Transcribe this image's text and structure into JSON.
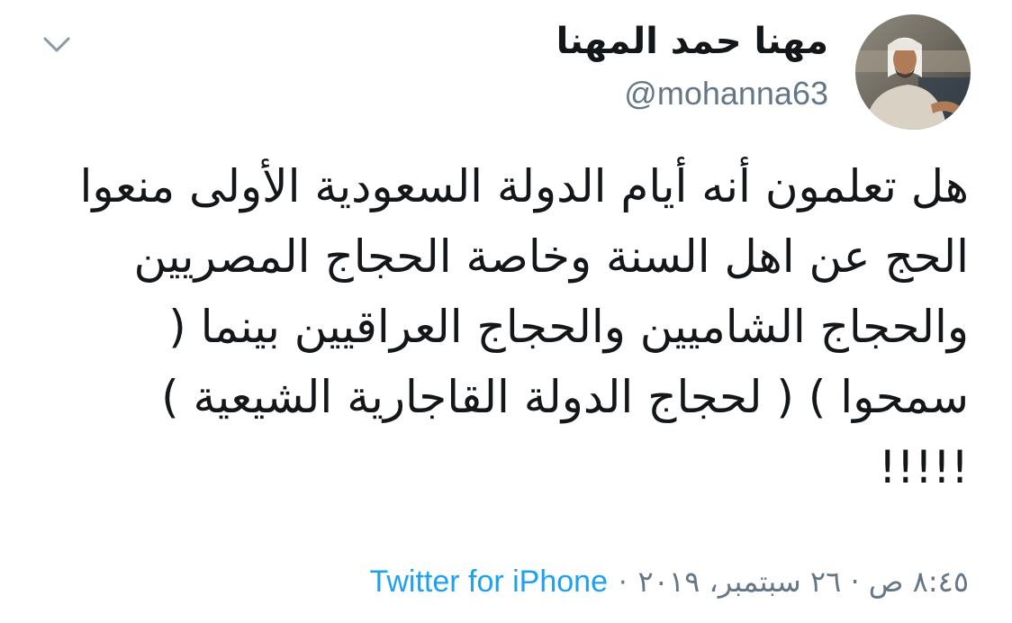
{
  "author": {
    "display_name": "مهنا حمد المهنا",
    "handle": "@mohanna63",
    "avatar_icon": "user-photo-avatar"
  },
  "menu": {
    "icon": "chevron-down-icon"
  },
  "tweet": {
    "lines": [
      "هل تعلمون أنه أيام الدولة السعودية الأولى منعوا",
      "الحج عن اهل السنة وخاصة الحجاج المصريين",
      "والحجاج الشاميين والحجاج العراقيين بينما (",
      "سمحوا ) ( لحجاج الدولة القاجارية الشيعية )",
      "!!!!!"
    ]
  },
  "footer": {
    "timestamp": "٨:٤٥ ص · ٢٦ سبتمبر، ٢٠١٩",
    "separator": "·",
    "source": "Twitter for iPhone"
  },
  "colors": {
    "text": "#14171a",
    "secondary": "#657786",
    "link": "#1da1f2"
  }
}
